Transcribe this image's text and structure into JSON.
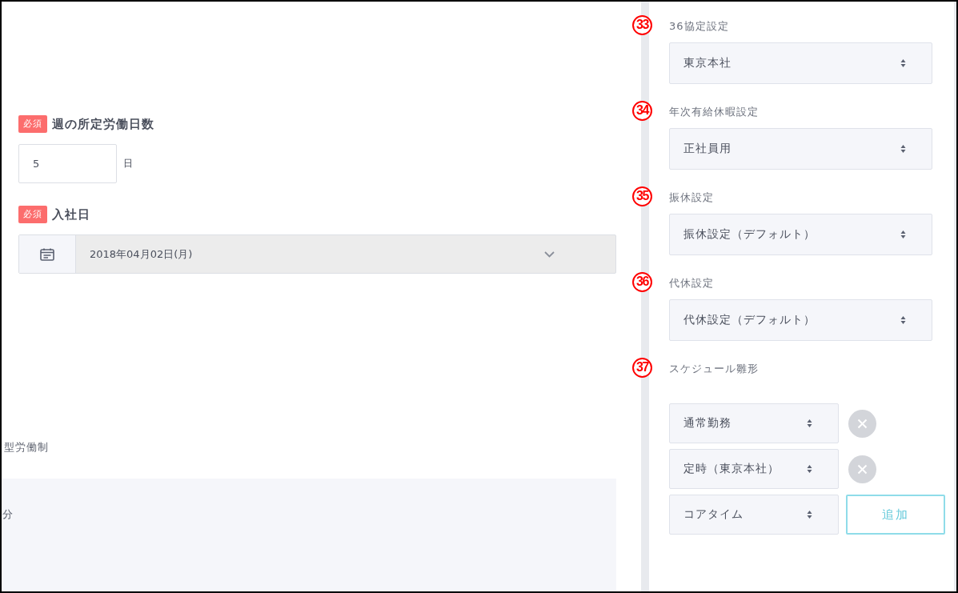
{
  "workdays": {
    "badge": "必須",
    "label": "週の所定労働日数",
    "value": "5",
    "unit": "日"
  },
  "hire_date": {
    "badge": "必須",
    "label": "入社日",
    "value": "2018年04月02日(月)"
  },
  "cut_text": "型労働制",
  "panel_text": "分",
  "settings": [
    {
      "marker": "33",
      "label": "36協定設定",
      "value": "東京本社"
    },
    {
      "marker": "34",
      "label": "年次有給休暇設定",
      "value": "正社員用"
    },
    {
      "marker": "35",
      "label": "振休設定",
      "value": "振休設定（デフォルト）"
    },
    {
      "marker": "36",
      "label": "代休設定",
      "value": "代休設定（デフォルト）"
    }
  ],
  "schedule": {
    "marker": "37",
    "label": "スケジュール雛形",
    "rows": [
      {
        "value": "通常勤務",
        "kind": "remove"
      },
      {
        "value": "定時（東京本社）",
        "kind": "remove"
      },
      {
        "value": "コアタイム",
        "kind": "add",
        "button": "追加"
      }
    ]
  }
}
